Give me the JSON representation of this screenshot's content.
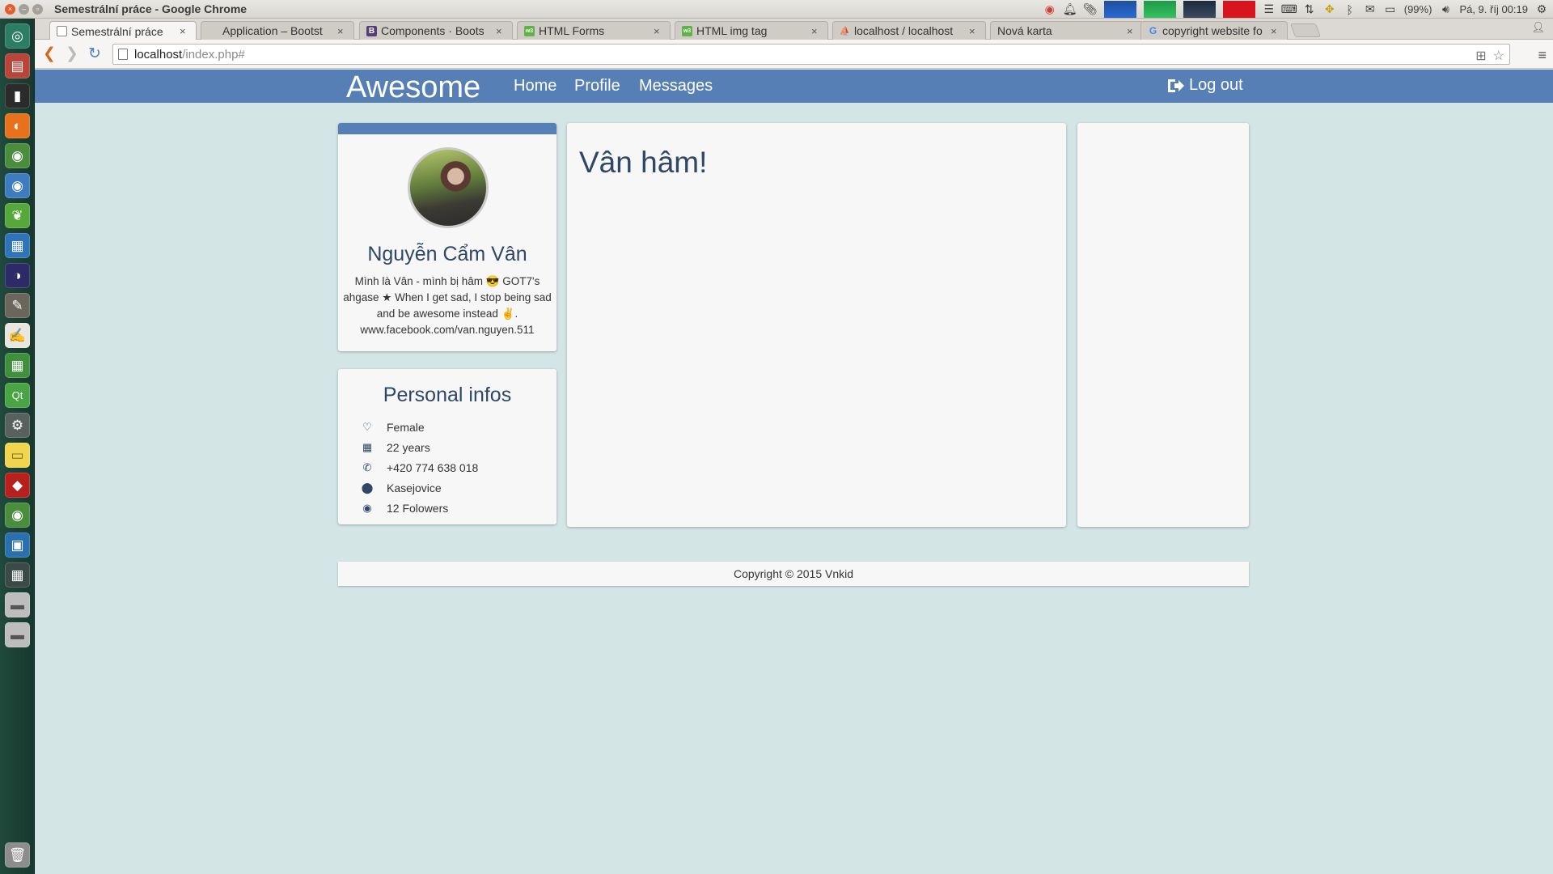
{
  "system": {
    "window_title": "Semestrální práce - Google Chrome",
    "battery": "(99%)",
    "datetime": "Pá, 9. říj 00:19"
  },
  "launcher": {
    "items": [
      "dash",
      "files",
      "terminal",
      "firefox",
      "chrome",
      "chromium",
      "leaf-app",
      "libreoffice-writer",
      "eclipse",
      "gimp",
      "text-editor",
      "libreoffice-calc",
      "qt-creator",
      "settings",
      "sticky-notes",
      "ruby",
      "chrome-alt",
      "remote-desktop",
      "workspace-switcher",
      "drive-1",
      "drive-2",
      "trash"
    ]
  },
  "tabs": [
    {
      "label": "Semestrální práce",
      "favicon": "page",
      "active": true
    },
    {
      "label": "Application – Bootst",
      "favicon": "none",
      "active": false
    },
    {
      "label": "Components · Boots",
      "favicon": "B",
      "active": false
    },
    {
      "label": "HTML Forms",
      "favicon": "w3",
      "active": false
    },
    {
      "label": "HTML img tag",
      "favicon": "w3",
      "active": false
    },
    {
      "label": "localhost / localhost",
      "favicon": "pma",
      "active": false
    },
    {
      "label": "Nová karta",
      "favicon": "none",
      "active": false
    },
    {
      "label": "copyright website fo",
      "favicon": "G",
      "active": false
    }
  ],
  "address": {
    "host": "localhost",
    "path": "/index.php#"
  },
  "navbar": {
    "brand": "Awesome",
    "links": [
      "Home",
      "Profile",
      "Messages"
    ],
    "logout": "Log out"
  },
  "profile": {
    "name": "Nguyễn Cẩm Vân",
    "bio": "Mình là Vân - mình bị hâm 😎 GOT7's ahgase ★ When I get sad, I stop being sad and be awesome instead ✌. www.facebook.com/van.nguyen.511"
  },
  "personal_infos": {
    "title": "Personal infos",
    "rows": [
      {
        "icon": "heart-icon",
        "text": "Female"
      },
      {
        "icon": "calendar-icon",
        "text": "22 years"
      },
      {
        "icon": "phone-icon",
        "text": "+420 774 638 018"
      },
      {
        "icon": "map-marker-icon",
        "text": "Kasejovice"
      },
      {
        "icon": "eye-icon",
        "text": "12 Folowers"
      }
    ]
  },
  "main": {
    "heading": "Vân hâm!"
  },
  "footer": {
    "text": "Copyright © 2015 Vnkid"
  },
  "colors": {
    "navbar": "#567fb5",
    "background": "#d4e5e6",
    "heading": "#2e4766"
  }
}
